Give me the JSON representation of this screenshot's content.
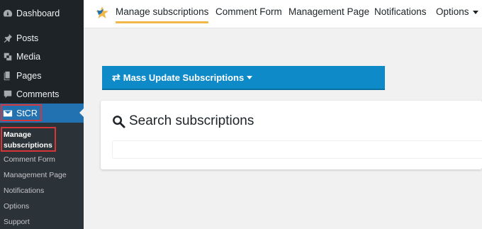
{
  "sidebar": {
    "items": [
      {
        "label": "Dashboard",
        "icon": "dashboard-icon"
      },
      {
        "label": "Posts",
        "icon": "pin-icon"
      },
      {
        "label": "Media",
        "icon": "media-icon"
      },
      {
        "label": "Pages",
        "icon": "pages-icon"
      },
      {
        "label": "Comments",
        "icon": "comment-icon"
      },
      {
        "label": "StCR",
        "icon": "envelope-icon"
      }
    ],
    "submenu": [
      {
        "label": "Manage subscriptions"
      },
      {
        "label": "Comment Form"
      },
      {
        "label": "Management Page"
      },
      {
        "label": "Notifications"
      },
      {
        "label": "Options"
      },
      {
        "label": "Support"
      }
    ]
  },
  "tabs": [
    {
      "label": "Manage subscriptions"
    },
    {
      "label": "Comment Form"
    },
    {
      "label": "Management Page"
    },
    {
      "label": "Notifications"
    },
    {
      "label": "Options"
    }
  ],
  "mass_update": {
    "label": "Mass Update Subscriptions"
  },
  "search": {
    "title": "Search subscriptions",
    "placeholder": ""
  },
  "colors": {
    "sidebar": "#1d2327",
    "accent": "#2271b1",
    "active_tab_underline": "#f0b849",
    "mass_update": "#0e8ac8",
    "highlight": "#d63638"
  }
}
